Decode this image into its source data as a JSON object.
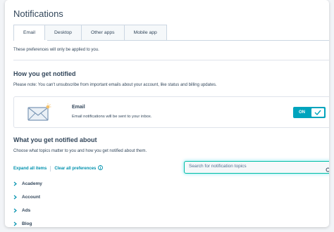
{
  "page": {
    "title": "Notifications"
  },
  "tabs": [
    {
      "label": "Email",
      "active": true
    },
    {
      "label": "Desktop",
      "active": false
    },
    {
      "label": "Other apps",
      "active": false
    },
    {
      "label": "Mobile app",
      "active": false
    }
  ],
  "helper_text": "These preferences will only be applied to you.",
  "how_notified": {
    "title": "How you get notified",
    "note": "Please note: You can't unsubscribe from important emails about your account, like status and billing updates."
  },
  "email_card": {
    "icon": "envelope-icon",
    "title": "Email",
    "description": "Email notifications will be sent to your inbox.",
    "toggle_label": "ON",
    "toggle_on": true
  },
  "what_notified": {
    "title": "What you get notified about",
    "note": "Choose what topics matter to you and how you get notified about them."
  },
  "actions": {
    "expand_all": "Expand all items",
    "clear_all": "Clear all preferences"
  },
  "search": {
    "placeholder": "Search for notification topics",
    "value": ""
  },
  "categories": [
    {
      "label": "Academy"
    },
    {
      "label": "Account"
    },
    {
      "label": "Ads"
    },
    {
      "label": "Blog"
    }
  ],
  "colors": {
    "accent": "#00a4bd",
    "link": "#0091ae",
    "text": "#33475b",
    "border": "#cbd6e2",
    "search_focus": "#00bda5"
  }
}
